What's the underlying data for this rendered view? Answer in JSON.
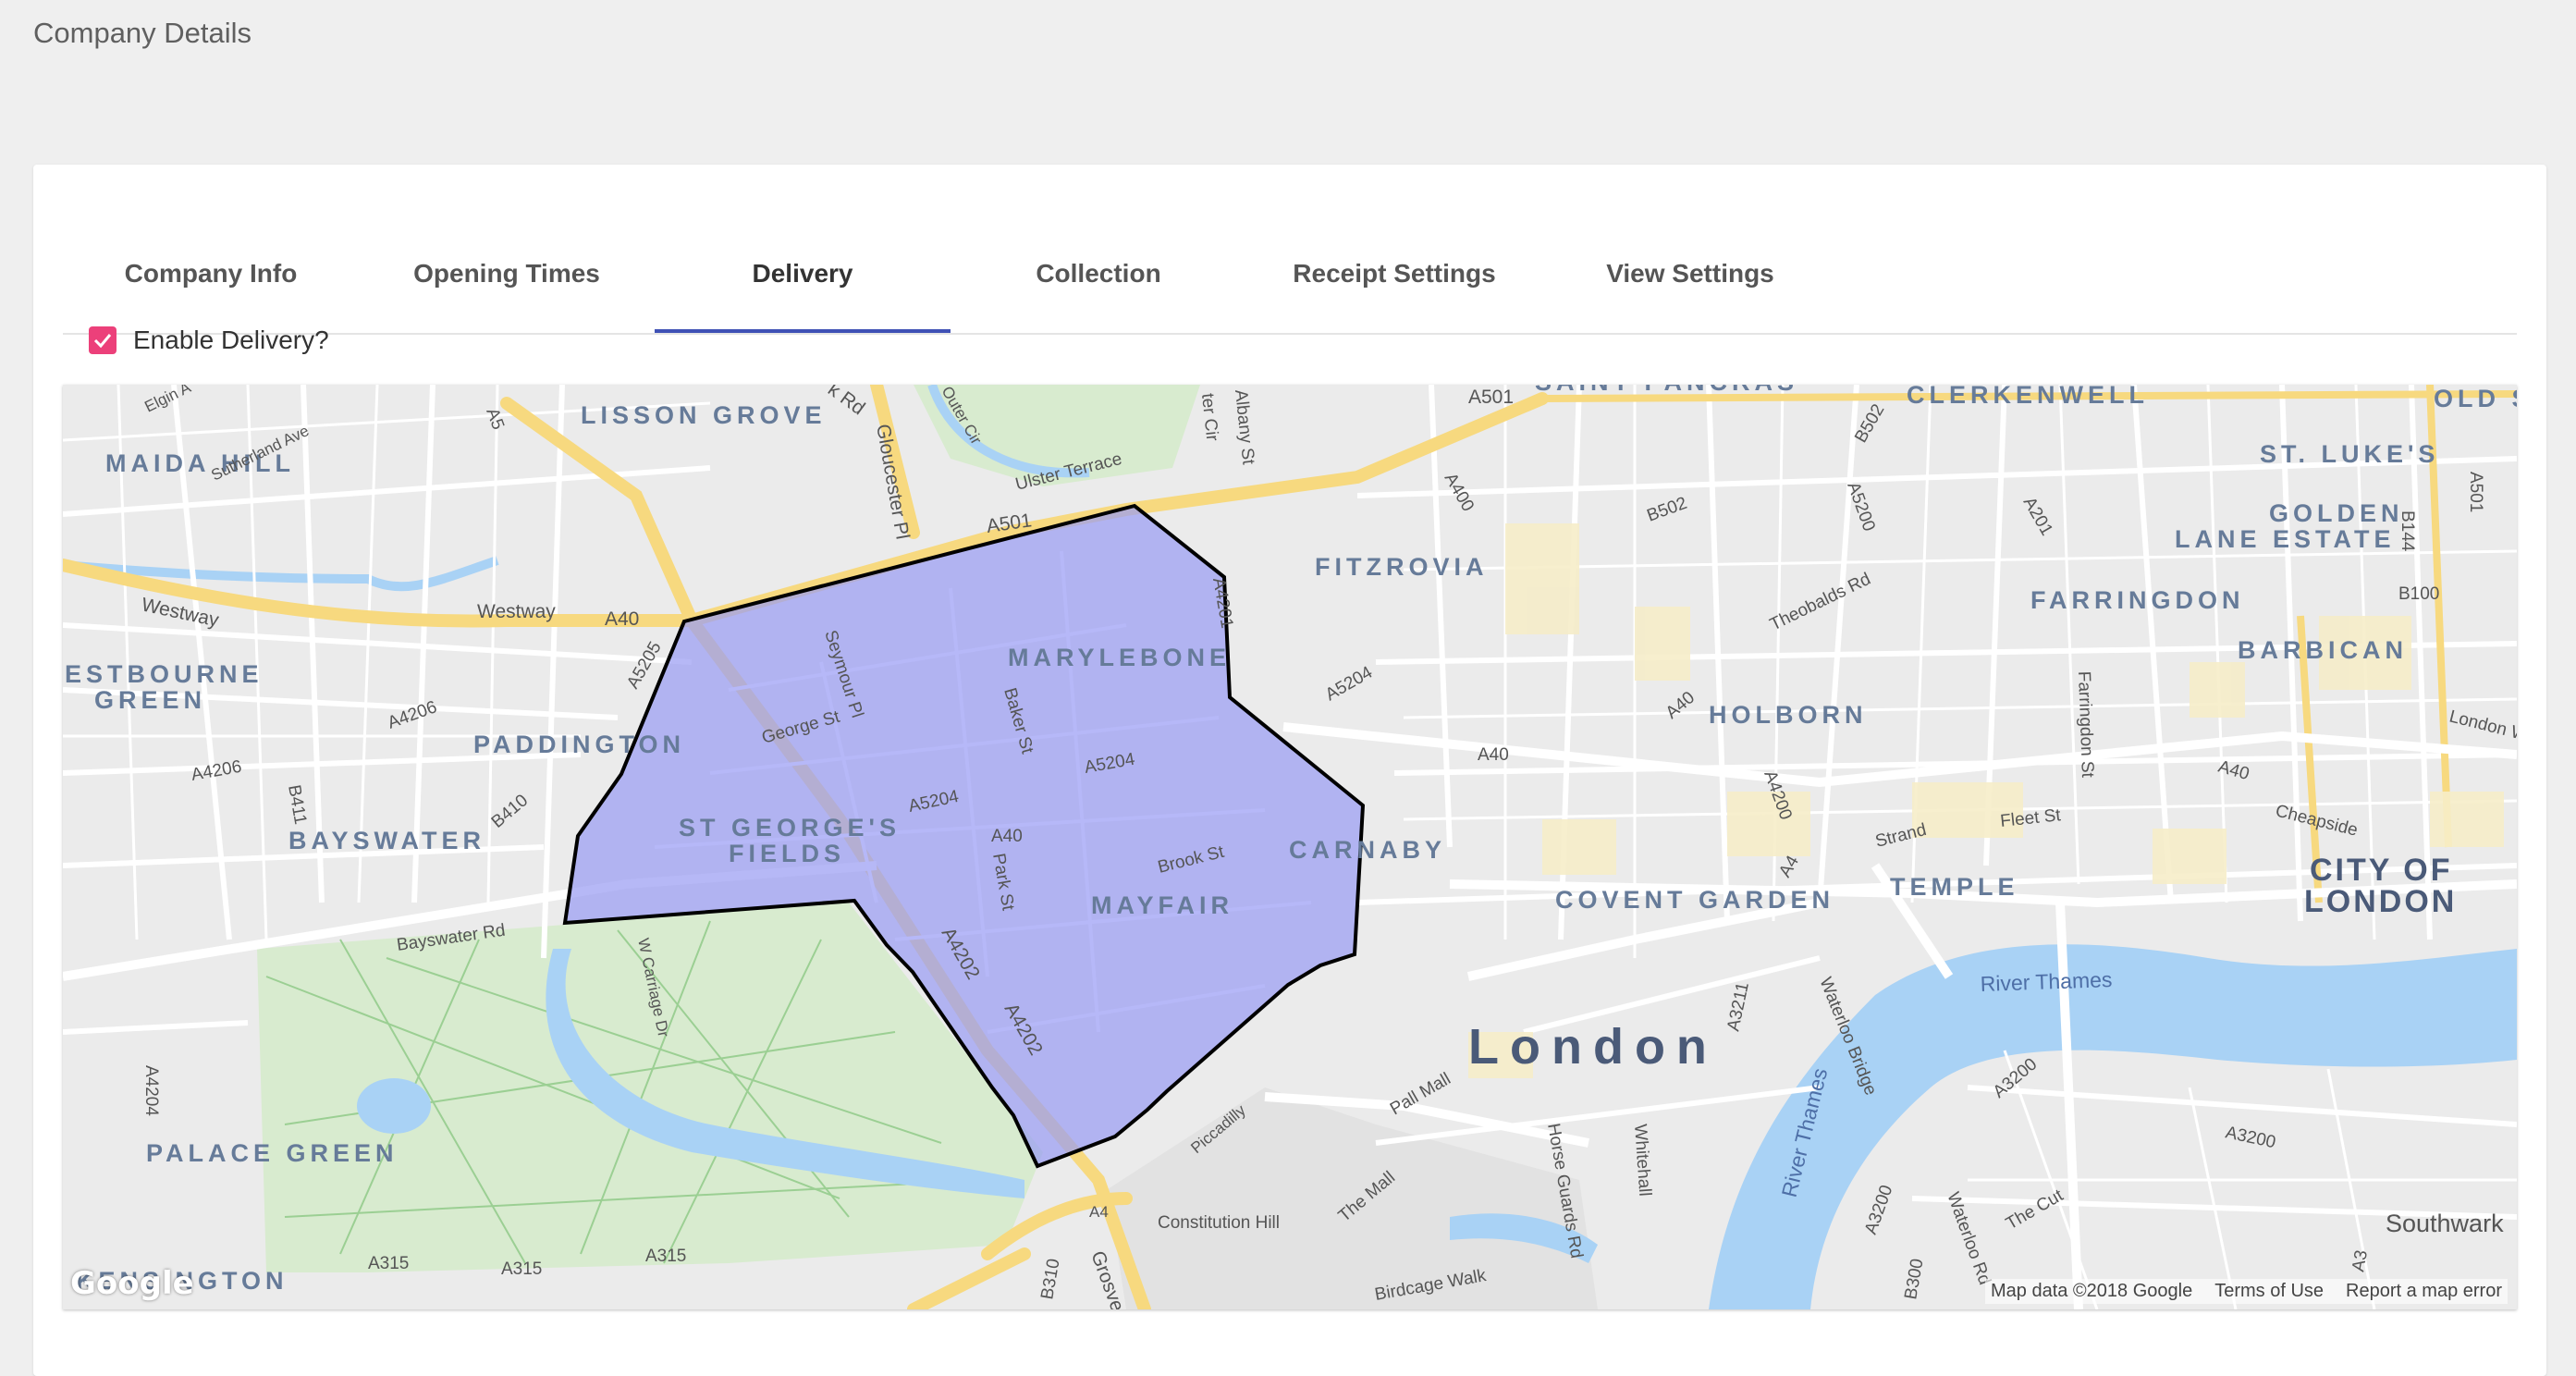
{
  "page": {
    "title": "Company Details"
  },
  "tabs": [
    {
      "label": "Company Info",
      "active": false
    },
    {
      "label": "Opening Times",
      "active": false
    },
    {
      "label": "Delivery",
      "active": true
    },
    {
      "label": "Collection",
      "active": false
    },
    {
      "label": "Receipt Settings",
      "active": false
    },
    {
      "label": "View Settings",
      "active": false
    }
  ],
  "delivery": {
    "enable_label": "Enable Delivery?",
    "enabled": true
  },
  "map": {
    "google_logo": "Google",
    "footer": {
      "map_data": "Map data ©2018 Google",
      "terms": "Terms of Use",
      "report": "Report a map error"
    },
    "districts": {
      "lisson_grove": "LISSON GROVE",
      "maida_hill": "MAIDA HILL",
      "estbourne_green_1": "ESTBOURNE",
      "estbourne_green_2": "GREEN",
      "paddington": "PADDINGTON",
      "bayswater": "BAYSWATER",
      "st_georges_1": "ST GEORGE'S",
      "st_georges_2": "FIELDS",
      "marylebone": "MARYLEBONE",
      "fitzrovia": "FITZROVIA",
      "mayfair": "MAYFAIR",
      "carnaby": "CARNABY",
      "covent_garden": "COVENT GARDEN",
      "holborn": "HOLBORN",
      "temple": "TEMPLE",
      "farringdon": "FARRINGDON",
      "barbican": "BARBICAN",
      "st_lukes": "ST. LUKE'S",
      "golden_lane_1": "GOLDEN",
      "golden_lane_2": "LANE ESTATE",
      "clerkenwell": "CLERKENWELL",
      "saint_pancras": "SAINT PANCRAS",
      "old_s": "OLD S",
      "city_of_london_1": "CITY OF",
      "city_of_london_2": "LONDON",
      "palace_green": "PALACE GREEN",
      "kensington": "KENSINGTON",
      "southwark": "Southwark",
      "london": "London"
    },
    "roads": {
      "westway_1": "Westway",
      "westway_2": "Westway",
      "a40_west": "A40",
      "a40_mid": "A40",
      "a40_east": "A40",
      "a40_holborn": "A40",
      "a40_city": "A40",
      "a501": "A501",
      "a501_north": "A501",
      "a501_city": "A501",
      "a5": "A5",
      "a5205": "A5205",
      "a4206": "A4206",
      "a4206_b": "A4206",
      "b411": "B411",
      "b410": "B410",
      "george_st": "George St",
      "seymour_pl": "Seymour Pl",
      "baker_st": "Baker St",
      "a5204_1": "A5204",
      "a5204_2": "A5204",
      "a5204_3": "A5204",
      "park_st": "Park St",
      "brook_st": "Brook St",
      "a4201": "A4201",
      "a400": "A400",
      "b502": "B502",
      "b502_b": "B502",
      "a5200": "A5200",
      "a201": "A201",
      "theobalds_rd": "Theobalds Rd",
      "a4200": "A4200",
      "a4": "A4",
      "a4_south": "A4",
      "strand": "Strand",
      "fleet_st": "Fleet St",
      "farringdon_st": "Farringdon St",
      "cheapside": "Cheapside",
      "london_wall": "London W",
      "b144": "B144",
      "b100": "B100",
      "a3211": "A3211",
      "waterloo_bridge": "Waterloo Bridge",
      "a3200_1": "A3200",
      "a3200_2": "A3200",
      "a3200_3": "A3200",
      "the_cut": "The Cut",
      "waterloo_rd": "Waterloo Rd",
      "b300": "B300",
      "a3": "A3",
      "pall_mall": "Pall Mall",
      "the_mall": "The Mall",
      "horse_guards_rd": "Horse Guards Rd",
      "whitehall": "Whitehall",
      "birdcage_walk": "Birdcage Walk",
      "constitution_hill": "Constitution Hill",
      "piccadilly": "Piccadilly",
      "a4202_1": "A4202",
      "a4202_2": "A4202",
      "bayswater_rd": "Bayswater Rd",
      "w_carriage_dr": "W Carriage Dr",
      "a4204": "A4204",
      "a315_1": "A315",
      "a315_2": "A315",
      "a315_3": "A315",
      "b310": "B310",
      "grosvenor": "Grosven",
      "gloucester_pl": "Gloucester Pl",
      "ulster_terrace": "Ulster Terrace",
      "albany_st": "Albany St",
      "sutherland_ave": "Sutherland Ave",
      "elgin": "Elgin A",
      "k_rd": "k Rd",
      "outer_cir": "Outer Cir",
      "ter_cir": "ter Cir"
    },
    "water": {
      "river_thames_1": "River Thames",
      "river_thames_2": "River Thames"
    },
    "colors": {
      "land": "#ebebeb",
      "road": "#ffffff",
      "major_road": "#f8dc82",
      "water": "#a9d2f5",
      "park": "#d7ecd0",
      "polygon_fill": "#9a9cf2",
      "polygon_stroke": "#000000"
    }
  }
}
